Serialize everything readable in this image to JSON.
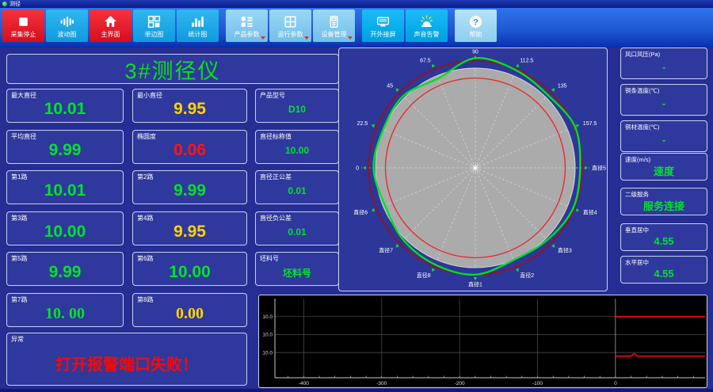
{
  "window": {
    "title": "测径"
  },
  "colors": {
    "green": "#00e32a",
    "yellow": "#ffd400",
    "red": "#ff1414",
    "alarm_red": "#f20b0b"
  },
  "toolbar": {
    "buttons": [
      {
        "name": "capture-stop-button",
        "label": "采集停止",
        "icon": "stop-icon",
        "variant": "red"
      },
      {
        "name": "wave-chart-button",
        "label": "波动图",
        "icon": "waveform-icon",
        "variant": "blue"
      },
      {
        "name": "main-screen-button",
        "label": "主界面",
        "icon": "home-icon",
        "variant": "red"
      },
      {
        "name": "single-side-chart-button",
        "label": "单边图",
        "icon": "panels-icon",
        "variant": "blue"
      },
      {
        "name": "stats-chart-button",
        "label": "统计图",
        "icon": "barchart-icon",
        "variant": "blue",
        "group_end": true
      },
      {
        "name": "product-params-button",
        "label": "产品参数",
        "icon": "list-grid-icon",
        "variant": "light",
        "dropdown": true
      },
      {
        "name": "run-params-button",
        "label": "运行参数",
        "icon": "window-grid-icon",
        "variant": "light",
        "dropdown": true
      },
      {
        "name": "device-manage-button",
        "label": "设备管理",
        "icon": "device-icon",
        "variant": "light",
        "dropdown": true,
        "group_end": true
      },
      {
        "name": "external-screen-button",
        "label": "开外接屏",
        "icon": "monitor-icon",
        "variant": "cyan"
      },
      {
        "name": "sound-alarm-button",
        "label": "声音告警",
        "icon": "siren-icon",
        "variant": "cyan",
        "group_end": true
      },
      {
        "name": "help-button",
        "label": "帮助",
        "icon": "help-icon",
        "variant": "help"
      }
    ]
  },
  "left_panel": {
    "title": "3#测径仪",
    "rows": [
      {
        "cells": [
          {
            "name": "max-diameter",
            "label": "最大直径",
            "value": "10.01",
            "color": "green",
            "size": "big"
          },
          {
            "name": "min-diameter",
            "label": "最小直径",
            "value": "9.95",
            "color": "yellow",
            "size": "big"
          },
          {
            "name": "product-model",
            "label": "产品型号",
            "value": "D10",
            "color": "green",
            "size": "small"
          }
        ]
      },
      {
        "cells": [
          {
            "name": "avg-diameter",
            "label": "平均直径",
            "value": "9.99",
            "color": "green",
            "size": "big"
          },
          {
            "name": "ovality",
            "label": "椭圆度",
            "value": "0.06",
            "color": "red",
            "size": "big"
          },
          {
            "name": "nominal-diameter",
            "label": "直径标称值",
            "value": "10.00",
            "color": "green",
            "size": "small"
          }
        ]
      },
      {
        "cells": [
          {
            "name": "channel-1",
            "label": "第1路",
            "value": "10.01",
            "color": "green",
            "size": "big"
          },
          {
            "name": "channel-2",
            "label": "第2路",
            "value": "9.99",
            "color": "green",
            "size": "big"
          },
          {
            "name": "plus-tolerance",
            "label": "直径正公差",
            "value": "0.01",
            "color": "green",
            "size": "small"
          }
        ]
      },
      {
        "cells": [
          {
            "name": "channel-3",
            "label": "第3路",
            "value": "10.00",
            "color": "green",
            "size": "big"
          },
          {
            "name": "channel-4",
            "label": "第4路",
            "value": "9.95",
            "color": "yellow",
            "size": "big"
          },
          {
            "name": "minus-tolerance",
            "label": "直径负公差",
            "value": "0.01",
            "color": "green",
            "size": "small"
          }
        ]
      },
      {
        "cells": [
          {
            "name": "channel-5",
            "label": "第5路",
            "value": "9.99",
            "color": "green",
            "size": "big"
          },
          {
            "name": "channel-6",
            "label": "第6路",
            "value": "10.00",
            "color": "green",
            "size": "big"
          },
          {
            "name": "billet-no",
            "label": "坯料号",
            "value": "坯料号",
            "color": "green",
            "size": "small"
          }
        ]
      },
      {
        "cells": [
          {
            "name": "channel-7",
            "label": "第7路",
            "value": "10. 00",
            "color": "green",
            "size": "big",
            "font": "serif"
          },
          {
            "name": "channel-8",
            "label": "第8路",
            "value": "0.00",
            "color": "yellow",
            "size": "big",
            "font": "serif"
          }
        ]
      }
    ],
    "alarm": {
      "name": "alarm",
      "label": "异常",
      "value": "打开报警端口失败！"
    }
  },
  "right_panel": {
    "items": [
      {
        "name": "air-pressure",
        "label": "风口风压(Pa)",
        "value": "-"
      },
      {
        "name": "bar-temperature",
        "label": "铜条温度(℃)",
        "value": "-"
      },
      {
        "name": "material-temperature",
        "label": "铜材温度(℃)",
        "value": "-"
      },
      {
        "name": "speed",
        "label": "速度(m/s)",
        "value": "速度"
      },
      {
        "name": "secondary-service",
        "label": "二级服务",
        "value": "服务连接"
      },
      {
        "name": "vertical-center",
        "label": "垂直居中",
        "value": "4.55"
      },
      {
        "name": "horizontal-center",
        "label": "水平居中",
        "value": "4.55"
      }
    ]
  },
  "chart_data": [
    {
      "type": "polar",
      "title": "圆度轮廓图",
      "angle_step_deg": 22.5,
      "spokes": [
        {
          "angle": 0,
          "label": "直径5"
        },
        {
          "angle": 22.5,
          "label": "157.5"
        },
        {
          "angle": 45,
          "label": "135"
        },
        {
          "angle": 67.5,
          "label": "112.5"
        },
        {
          "angle": 90,
          "label": "90"
        },
        {
          "angle": 112.5,
          "label": "67.5"
        },
        {
          "angle": 135,
          "label": "45"
        },
        {
          "angle": 157.5,
          "label": "22.5"
        },
        {
          "angle": 180,
          "label": "0"
        },
        {
          "angle": 202.5,
          "label": "直径6"
        },
        {
          "angle": 225,
          "label": "直径7"
        },
        {
          "angle": 247.5,
          "label": "直径8"
        },
        {
          "angle": 270,
          "label": "直径1"
        },
        {
          "angle": 292.5,
          "label": "直径2"
        },
        {
          "angle": 315,
          "label": "直径3"
        },
        {
          "angle": 337.5,
          "label": "直径4"
        }
      ],
      "rings": {
        "body": 1.0,
        "outer_tolerance": 1.07,
        "inner_tolerance": 0.9
      },
      "profile_radii": [
        1.05,
        1.08,
        1.03,
        1.06,
        1.1,
        0.97,
        1.02,
        1.0,
        1.02,
        0.98,
        1.02,
        1.05,
        1.07,
        1.0,
        1.02,
        1.06
      ],
      "profile_color": "#00e020",
      "body_color": "#ababab",
      "outer_ring_color": "#a01010",
      "inner_ring_color": "#ee2222",
      "spoke_color": "#e0e0e0"
    },
    {
      "type": "line",
      "title": "直径趋势图",
      "background": "#000000",
      "xlim": [
        -437,
        115
      ],
      "ylim": [
        9.88,
        10.1
      ],
      "x_ticks": [
        -400,
        -300,
        -200,
        -100,
        0
      ],
      "x_minor_tick_step": 20,
      "y_ticks": [
        {
          "value": 10.05,
          "label": "10.0"
        },
        {
          "value": 10.0,
          "label": "10.0"
        },
        {
          "value": 9.95,
          "label": "10.0"
        }
      ],
      "grid": true,
      "grid_color": "#464646",
      "zero_line_color": "#a8a8a8",
      "axis_color": "#c8c8c8",
      "series": [
        {
          "name": "upper-tolerance-line",
          "color": "#ff0000",
          "points": [
            [
              0,
              10.05
            ],
            [
              115,
              10.05
            ]
          ]
        },
        {
          "name": "lower-tolerance-line",
          "color": "#ff0000",
          "points": [
            [
              0,
              9.94
            ],
            [
              20,
              9.94
            ],
            [
              24,
              9.947
            ],
            [
              28,
              9.94
            ],
            [
              115,
              9.94
            ]
          ]
        }
      ]
    }
  ]
}
